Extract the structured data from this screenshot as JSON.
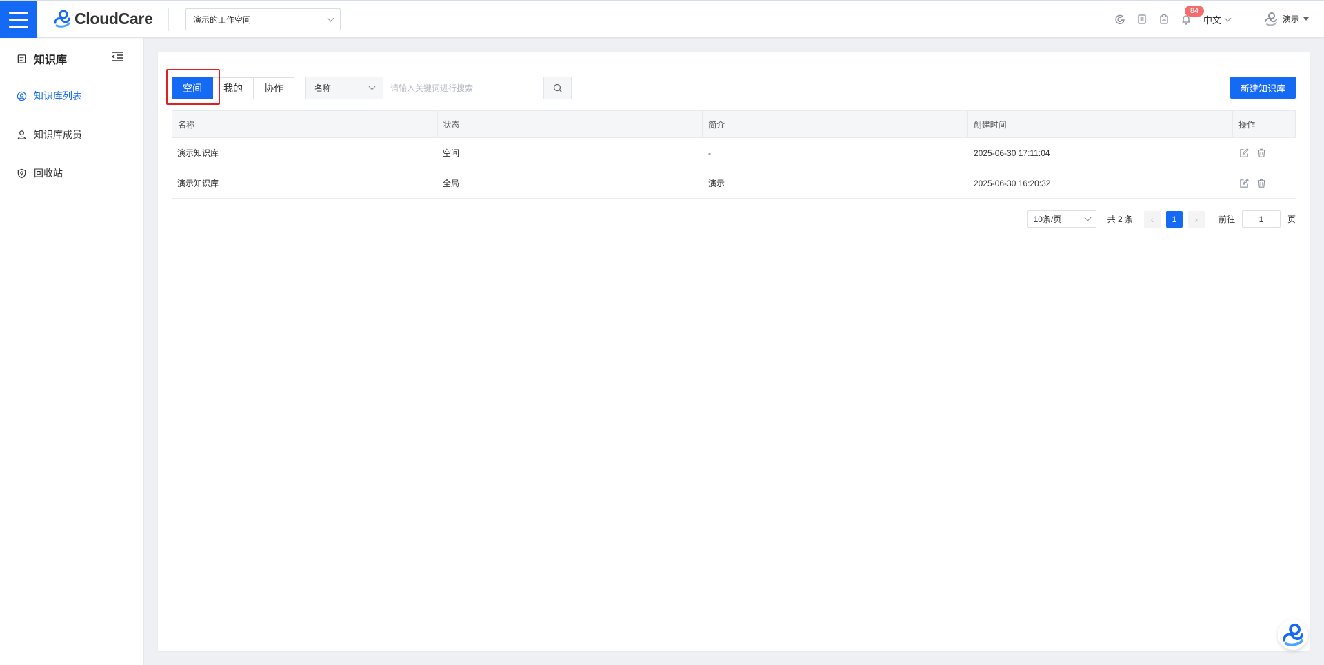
{
  "header": {
    "brand": "CloudCare",
    "workspace": "演示的工作空间",
    "notifications_count": "84",
    "language": "中文",
    "user": "演示"
  },
  "sidebar": {
    "title": "知识库",
    "items": [
      {
        "label": "知识库列表",
        "icon": "user-circle-icon",
        "active": true
      },
      {
        "label": "知识库成员",
        "icon": "member-icon",
        "active": false
      },
      {
        "label": "回收站",
        "icon": "recycle-bin-icon",
        "active": false
      }
    ]
  },
  "toolbar": {
    "tabs": [
      "空间",
      "我的",
      "协作"
    ],
    "active_tab": "空间",
    "filter_field": "名称",
    "search_placeholder": "请输入关键词进行搜索",
    "new_button": "新建知识库"
  },
  "table": {
    "columns": [
      "名称",
      "状态",
      "简介",
      "创建时间",
      "操作"
    ],
    "rows": [
      {
        "name": "演示知识库",
        "status": "空间",
        "intro": "-",
        "created": "2025-06-30 17:11:04"
      },
      {
        "name": "演示知识库",
        "status": "全局",
        "intro": "演示",
        "created": "2025-06-30 16:20:32"
      }
    ]
  },
  "pagination": {
    "page_size": "10条/页",
    "total": "共 2 条",
    "current_page": "1",
    "goto_label": "前往",
    "goto_value": "1",
    "page_suffix": "页"
  },
  "colors": {
    "primary": "#1469f5",
    "highlight_border": "#e02020",
    "badge": "#f56c6c"
  }
}
